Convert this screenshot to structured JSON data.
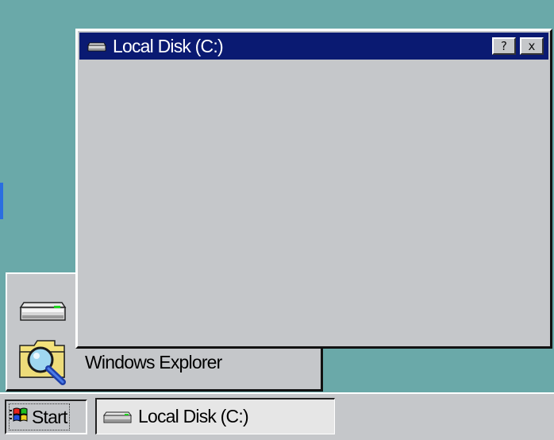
{
  "window": {
    "title": "Local Disk (C:)",
    "help_label": "?",
    "close_label": "x",
    "icon": "drive-icon"
  },
  "start_panel": {
    "items": [
      {
        "icon": "drive-icon",
        "label": ""
      },
      {
        "icon": "explorer-icon",
        "label": "Windows Explorer"
      }
    ]
  },
  "taskbar": {
    "start_label": "Start",
    "start_icon": "windows-logo-icon",
    "tasks": [
      {
        "label": "Local Disk (C:)",
        "icon": "drive-icon"
      }
    ]
  },
  "colors": {
    "desktop": "#6aa9a9",
    "titlebar": "#0a1a72",
    "face": "#c5c7ca"
  }
}
